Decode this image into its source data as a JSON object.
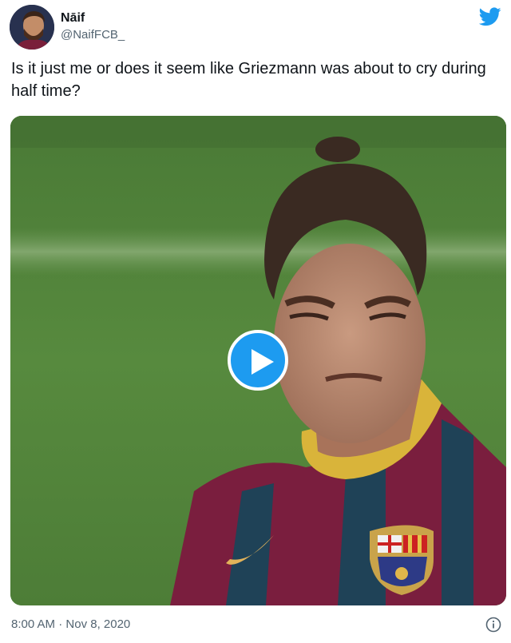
{
  "author": {
    "display_name": "Nāif",
    "handle": "@NaifFCB_",
    "avatar_icon": "user-avatar"
  },
  "brand": {
    "logo_icon": "twitter-bird-icon",
    "color": "#1d9bf0"
  },
  "tweet": {
    "text": "Is it just me or does it seem like Griezmann was about to cry during half time?"
  },
  "media": {
    "type": "video",
    "play_icon": "play-icon"
  },
  "meta": {
    "time": "8:00 AM",
    "separator": " · ",
    "date": "Nov 8, 2020",
    "info_icon": "info-icon"
  }
}
